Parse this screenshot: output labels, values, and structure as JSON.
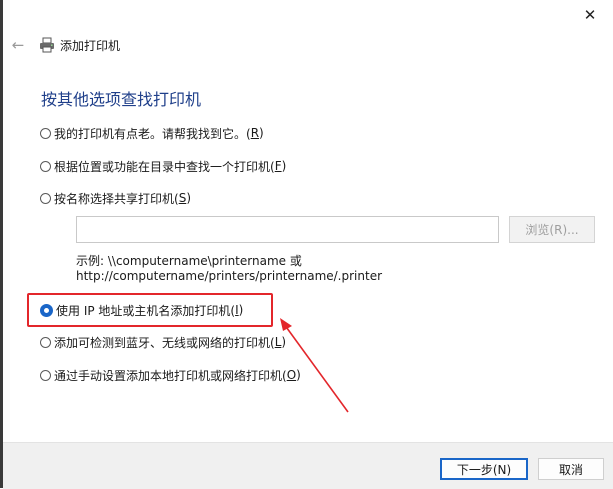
{
  "window": {
    "title": "添加打印机",
    "close_glyph": "✕",
    "back_glyph": "←"
  },
  "heading": "按其他选项查找打印机",
  "options": [
    {
      "label": "我的打印机有点老。请帮我找到它。(",
      "hotkey": "R",
      "suffix": ")",
      "checked": false
    },
    {
      "label": "根据位置或功能在目录中查找一个打印机(",
      "hotkey": "F",
      "suffix": ")",
      "checked": false
    },
    {
      "label": "按名称选择共享打印机(",
      "hotkey": "S",
      "suffix": ")",
      "checked": false
    },
    {
      "label": "使用 IP 地址或主机名添加打印机(",
      "hotkey": "I",
      "suffix": ")",
      "checked": true
    },
    {
      "label": "添加可检测到蓝牙、无线或网络的打印机(",
      "hotkey": "L",
      "suffix": ")",
      "checked": false
    },
    {
      "label": "通过手动设置添加本地打印机或网络打印机(",
      "hotkey": "O",
      "suffix": ")",
      "checked": false
    }
  ],
  "shared_name": {
    "value": "",
    "browse_label": "浏览(R)...",
    "example_line1": "示例: \\\\computername\\printername 或",
    "example_line2": "http://computername/printers/printername/.printer"
  },
  "footer": {
    "next_label": "下一步(N)",
    "cancel_label": "取消"
  },
  "colors": {
    "accent": "#1a66c8",
    "heading": "#1f3f8a",
    "annotation": "#e3262b"
  }
}
